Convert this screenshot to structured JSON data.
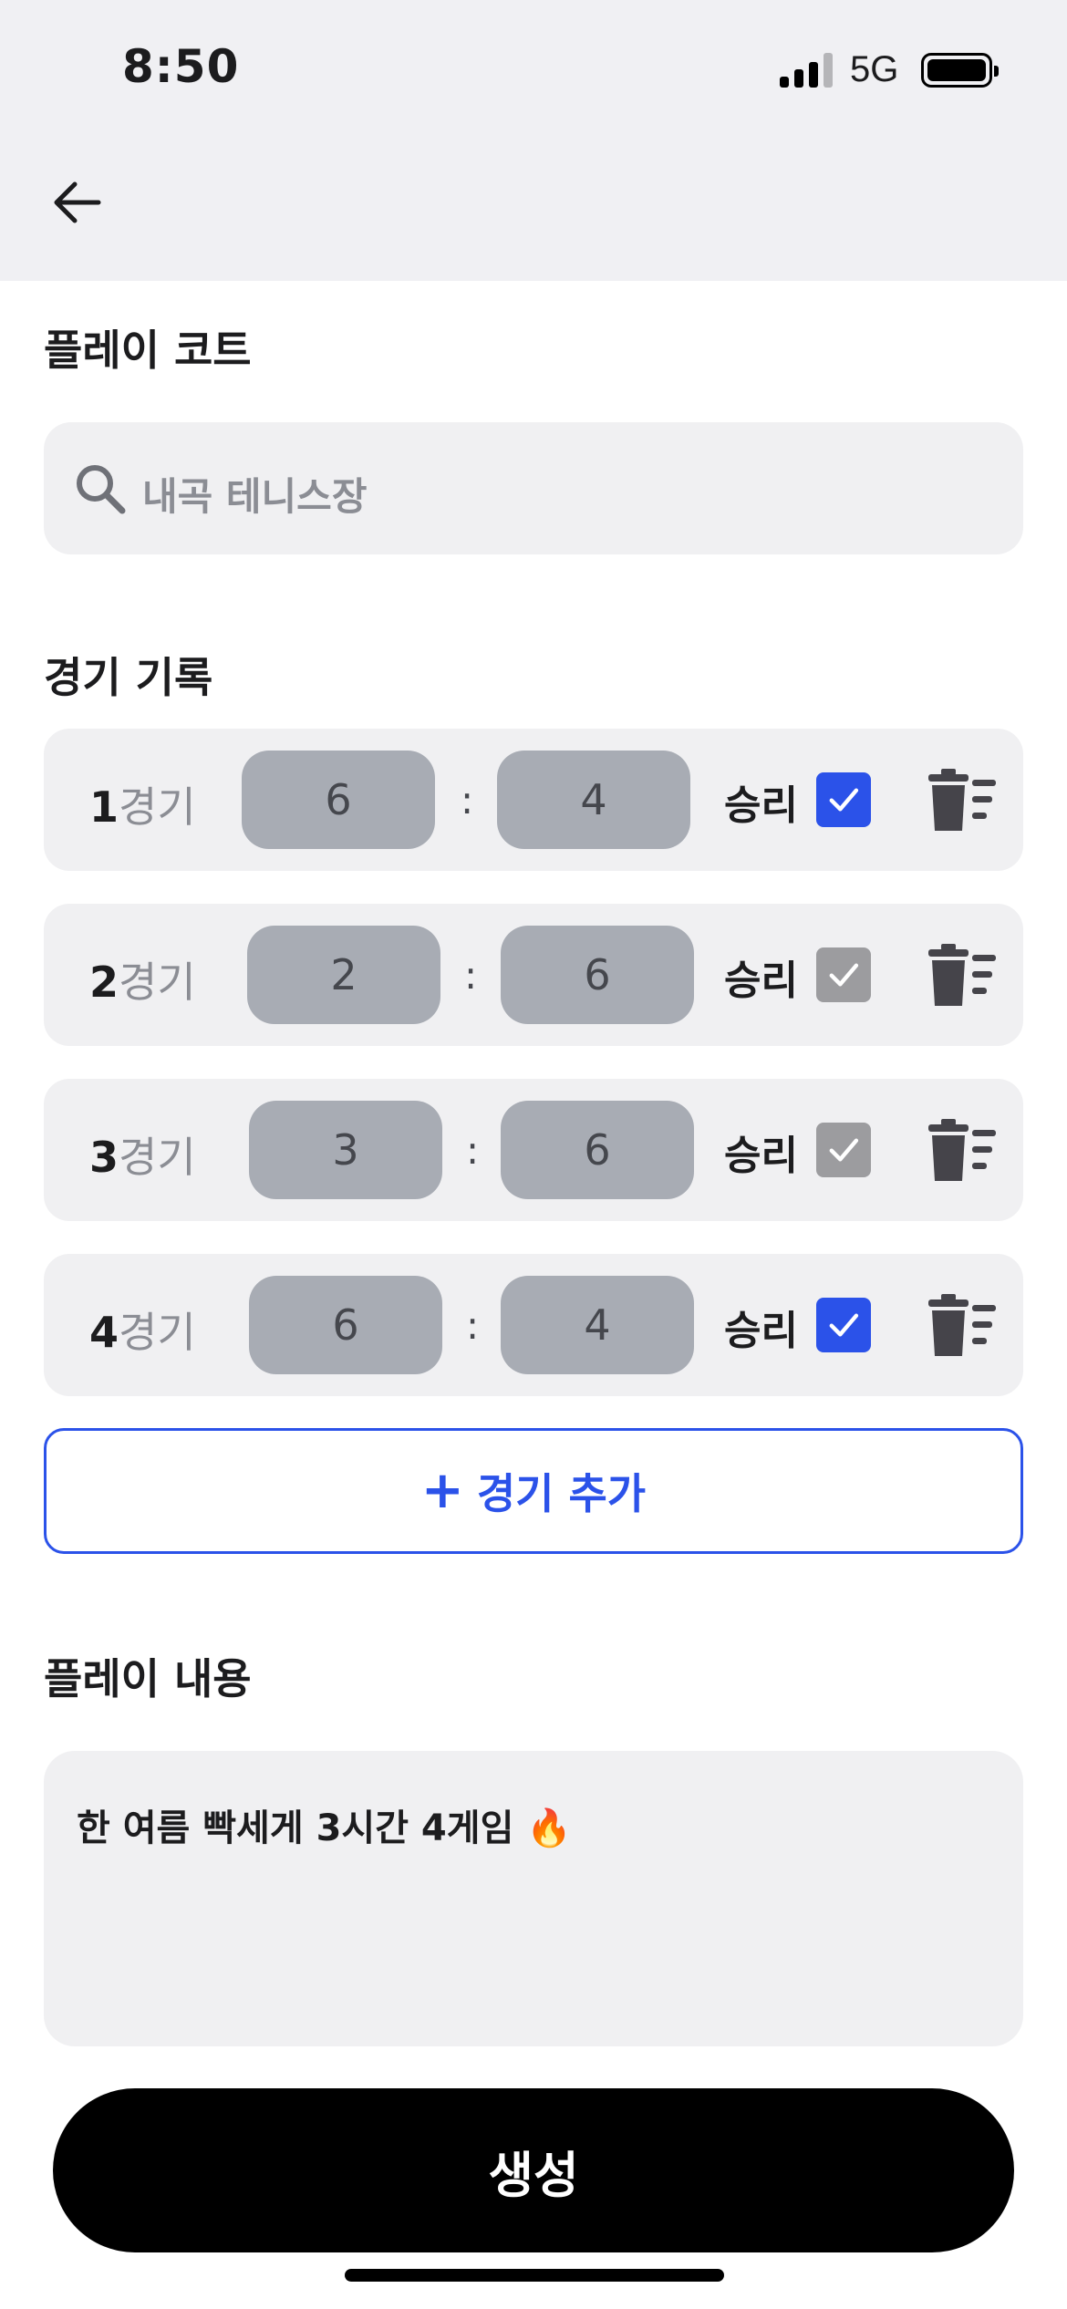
{
  "status_bar": {
    "time": "8:50",
    "network": "5G"
  },
  "court": {
    "title": "플레이 코트",
    "search_value": "내곡 테니스장"
  },
  "records": {
    "title": "경기 기록",
    "game_suffix": "경기",
    "win_label": "승리",
    "games": [
      {
        "number": "1",
        "score_a": "6",
        "score_b": "4",
        "win": true
      },
      {
        "number": "2",
        "score_a": "2",
        "score_b": "6",
        "win": false
      },
      {
        "number": "3",
        "score_a": "3",
        "score_b": "6",
        "win": false
      },
      {
        "number": "4",
        "score_a": "6",
        "score_b": "4",
        "win": true
      }
    ],
    "add_label": "경기 추가"
  },
  "content": {
    "title": "플레이 내용",
    "text": "한 여름 빡세게 3시간 4게임 🔥"
  },
  "create_label": "생성",
  "colors": {
    "accent": "#2b52e9",
    "check_off": "#9c9c9f",
    "score_bg": "#a8acb4"
  }
}
